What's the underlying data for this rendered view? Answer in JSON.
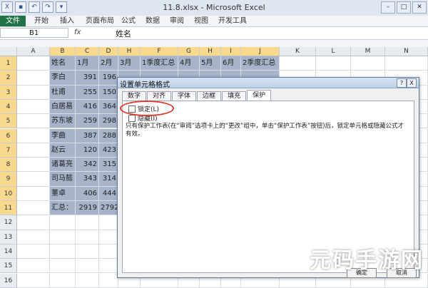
{
  "window": {
    "title": "11.8.xlsx - Microsoft Excel"
  },
  "ribbon": {
    "tabs": [
      "文件",
      "开始",
      "插入",
      "页面布局",
      "公式",
      "数据",
      "审阅",
      "视图",
      "开发工具"
    ]
  },
  "formula_bar": {
    "name_box": "B1",
    "fx": "fx",
    "content": "姓名"
  },
  "grid": {
    "columns": [
      "A",
      "B",
      "C",
      "D",
      "H",
      "F",
      "G",
      "H",
      "I",
      "J",
      "K",
      "L",
      "M",
      "N"
    ],
    "rows": [
      "1",
      "2",
      "3",
      "4",
      "5",
      "6",
      "7",
      "8",
      "9",
      "10",
      "11",
      "12",
      "13",
      "14",
      "15",
      "16"
    ],
    "cells": [
      [
        "",
        "姓名",
        "1月",
        "2月",
        "3月",
        "1季度汇总",
        "4月",
        "5月",
        "6月",
        "2季度汇总"
      ],
      [
        "",
        "李白",
        "391",
        "196"
      ],
      [
        "",
        "杜甫",
        "255",
        "150"
      ],
      [
        "",
        "白居易",
        "416",
        "364"
      ],
      [
        "",
        "苏东坡",
        "259",
        "298"
      ],
      [
        "",
        "李曲",
        "387",
        "288"
      ],
      [
        "",
        "赵云",
        "120",
        "423"
      ],
      [
        "",
        "诸葛亮",
        "342",
        "315"
      ],
      [
        "",
        "司马懿",
        "343",
        "314"
      ],
      [
        "",
        "董卓",
        "406",
        "444"
      ],
      [
        "",
        "汇总：",
        "2919",
        "2792"
      ]
    ]
  },
  "dialog": {
    "title": "设置单元格格式",
    "help": "?",
    "close": "X",
    "tabs": [
      "数字",
      "对齐",
      "字体",
      "边框",
      "填充",
      "保护"
    ],
    "locked_label": "锁定(L)",
    "hidden_label": "隐藏(I)",
    "note": "只有保护工作表(在“审阅”选项卡上的“更改”组中，单击“保护工作表”按钮)后，锁定单元格或隐藏公式才有效。",
    "ok": "确定",
    "cancel": "取消"
  },
  "watermark": "元码手游网"
}
